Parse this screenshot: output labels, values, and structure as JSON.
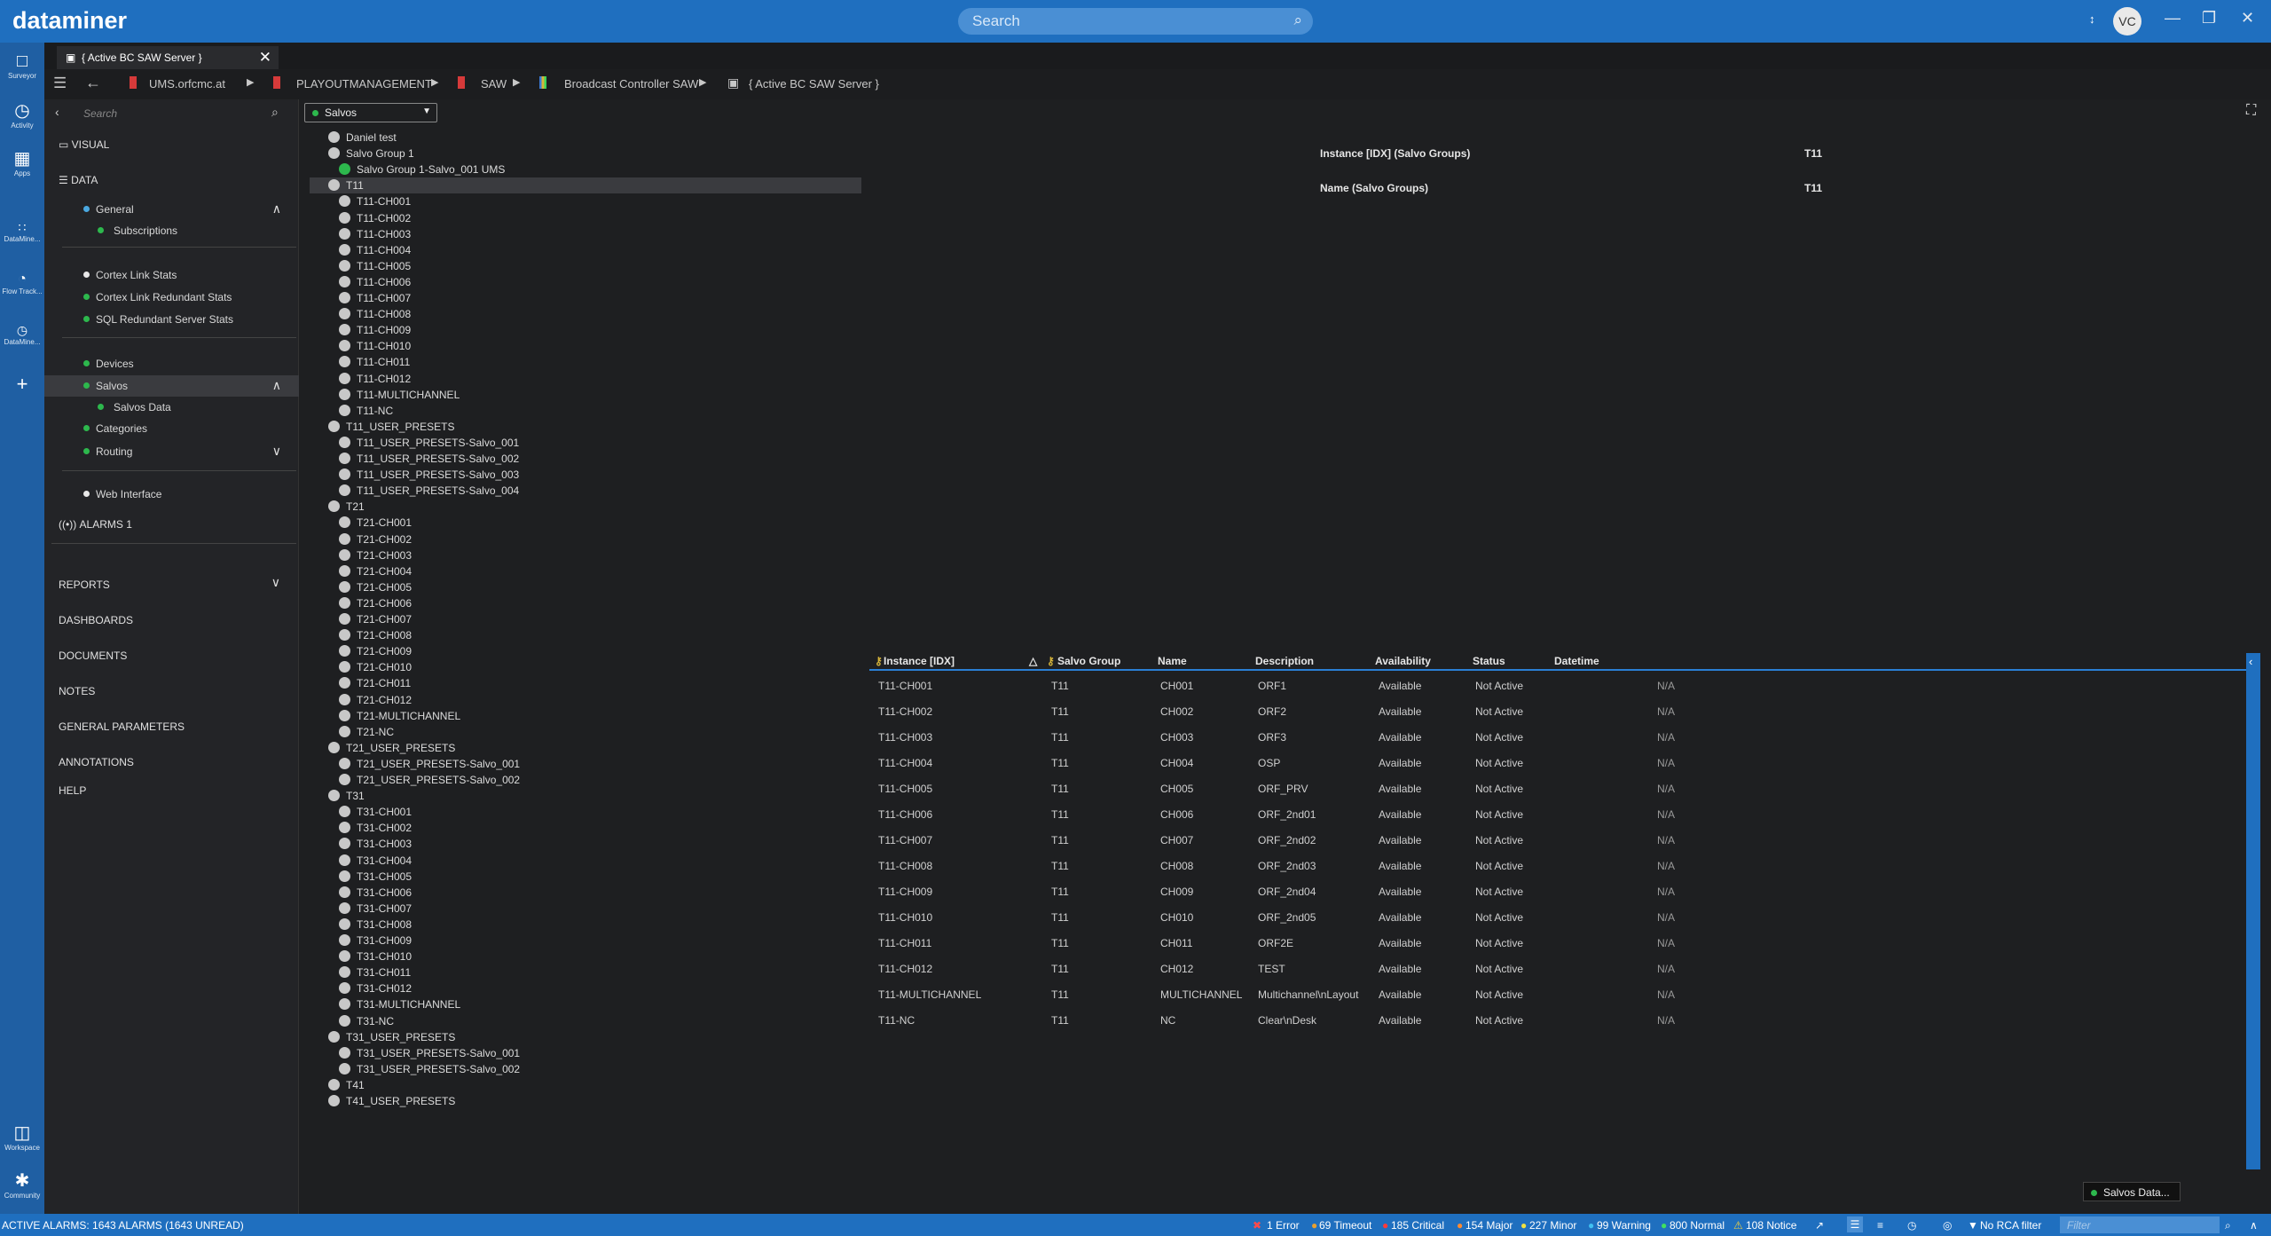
{
  "app": {
    "title": "dataminer",
    "search_placeholder": "Search",
    "user_initials": "VC"
  },
  "leftbar": {
    "items": [
      {
        "label": "Surveyor",
        "icon": "surveyor-icon"
      },
      {
        "label": "Activity",
        "icon": "clock-icon"
      },
      {
        "label": "Apps",
        "icon": "apps-icon"
      },
      {
        "label": "DataMine...",
        "icon": "datamine-icon"
      },
      {
        "label": "Flow Track...",
        "icon": "flow-icon"
      },
      {
        "label": "DataMine...",
        "icon": "datamine2-icon"
      },
      {
        "label": "Workspace",
        "icon": "workspace-icon"
      },
      {
        "label": "Community",
        "icon": "community-icon"
      }
    ]
  },
  "tab": {
    "label": "{ Active BC SAW Server }"
  },
  "breadcrumb": [
    "UMS.orfcmc.at",
    "PLAYOUTMANAGEMENT",
    "SAW",
    "Broadcast Controller SAW",
    "{ Active BC SAW Server }"
  ],
  "nav": {
    "search_placeholder": "Search",
    "visual": "VISUAL",
    "data": "DATA",
    "general": "General",
    "subscriptions": "Subscriptions",
    "cortex_link_stats": "Cortex Link Stats",
    "cortex_link_redundant_stats": "Cortex Link Redundant Stats",
    "sql_redundant_server_stats": "SQL Redundant Server Stats",
    "devices": "Devices",
    "salvos": "Salvos",
    "salvos_data": "Salvos Data",
    "categories": "Categories",
    "routing": "Routing",
    "web_interface": "Web Interface",
    "alarms": "ALARMS 1",
    "reports": "REPORTS",
    "dashboards": "DASHBOARDS",
    "documents": "DOCUMENTS",
    "notes": "NOTES",
    "general_parameters": "GENERAL PARAMETERS",
    "annotations": "ANNOTATIONS",
    "help": "HELP"
  },
  "salvo_dropdown": "Salvos",
  "tree": [
    {
      "label": "Daniel test",
      "level": 0
    },
    {
      "label": "Salvo Group 1",
      "level": 0
    },
    {
      "label": "Salvo Group 1-Salvo_001 UMS",
      "level": 1,
      "green": true
    },
    {
      "label": "T11",
      "level": 0,
      "selected": true
    },
    {
      "label": "T11-CH001",
      "level": 1
    },
    {
      "label": "T11-CH002",
      "level": 1
    },
    {
      "label": "T11-CH003",
      "level": 1
    },
    {
      "label": "T11-CH004",
      "level": 1
    },
    {
      "label": "T11-CH005",
      "level": 1
    },
    {
      "label": "T11-CH006",
      "level": 1
    },
    {
      "label": "T11-CH007",
      "level": 1
    },
    {
      "label": "T11-CH008",
      "level": 1
    },
    {
      "label": "T11-CH009",
      "level": 1
    },
    {
      "label": "T11-CH010",
      "level": 1
    },
    {
      "label": "T11-CH011",
      "level": 1
    },
    {
      "label": "T11-CH012",
      "level": 1
    },
    {
      "label": "T11-MULTICHANNEL",
      "level": 1
    },
    {
      "label": "T11-NC",
      "level": 1
    },
    {
      "label": "T11_USER_PRESETS",
      "level": 0
    },
    {
      "label": "T11_USER_PRESETS-Salvo_001",
      "level": 1
    },
    {
      "label": "T11_USER_PRESETS-Salvo_002",
      "level": 1
    },
    {
      "label": "T11_USER_PRESETS-Salvo_003",
      "level": 1
    },
    {
      "label": "T11_USER_PRESETS-Salvo_004",
      "level": 1
    },
    {
      "label": "T21",
      "level": 0
    },
    {
      "label": "T21-CH001",
      "level": 1
    },
    {
      "label": "T21-CH002",
      "level": 1
    },
    {
      "label": "T21-CH003",
      "level": 1
    },
    {
      "label": "T21-CH004",
      "level": 1
    },
    {
      "label": "T21-CH005",
      "level": 1
    },
    {
      "label": "T21-CH006",
      "level": 1
    },
    {
      "label": "T21-CH007",
      "level": 1
    },
    {
      "label": "T21-CH008",
      "level": 1
    },
    {
      "label": "T21-CH009",
      "level": 1
    },
    {
      "label": "T21-CH010",
      "level": 1
    },
    {
      "label": "T21-CH011",
      "level": 1
    },
    {
      "label": "T21-CH012",
      "level": 1
    },
    {
      "label": "T21-MULTICHANNEL",
      "level": 1
    },
    {
      "label": "T21-NC",
      "level": 1
    },
    {
      "label": "T21_USER_PRESETS",
      "level": 0
    },
    {
      "label": "T21_USER_PRESETS-Salvo_001",
      "level": 1
    },
    {
      "label": "T21_USER_PRESETS-Salvo_002",
      "level": 1
    },
    {
      "label": "T31",
      "level": 0
    },
    {
      "label": "T31-CH001",
      "level": 1
    },
    {
      "label": "T31-CH002",
      "level": 1
    },
    {
      "label": "T31-CH003",
      "level": 1
    },
    {
      "label": "T31-CH004",
      "level": 1
    },
    {
      "label": "T31-CH005",
      "level": 1
    },
    {
      "label": "T31-CH006",
      "level": 1
    },
    {
      "label": "T31-CH007",
      "level": 1
    },
    {
      "label": "T31-CH008",
      "level": 1
    },
    {
      "label": "T31-CH009",
      "level": 1
    },
    {
      "label": "T31-CH010",
      "level": 1
    },
    {
      "label": "T31-CH011",
      "level": 1
    },
    {
      "label": "T31-CH012",
      "level": 1
    },
    {
      "label": "T31-MULTICHANNEL",
      "level": 1
    },
    {
      "label": "T31-NC",
      "level": 1
    },
    {
      "label": "T31_USER_PRESETS",
      "level": 0
    },
    {
      "label": "T31_USER_PRESETS-Salvo_001",
      "level": 1
    },
    {
      "label": "T31_USER_PRESETS-Salvo_002",
      "level": 1
    },
    {
      "label": "T41",
      "level": 0
    },
    {
      "label": "T41_USER_PRESETS",
      "level": 0
    }
  ],
  "detail": {
    "instance_label": "Instance [IDX] (Salvo Groups)",
    "instance_value": "T11",
    "name_label": "Name (Salvo Groups)",
    "name_value": "T11"
  },
  "table": {
    "columns": [
      "Instance [IDX]",
      "Salvo Group",
      "Name",
      "Description",
      "Availability",
      "Status",
      "Datetime"
    ],
    "rows": [
      [
        "T11-CH001",
        "T11",
        "CH001",
        "ORF1",
        "Available",
        "Not Active",
        "N/A"
      ],
      [
        "T11-CH002",
        "T11",
        "CH002",
        "ORF2",
        "Available",
        "Not Active",
        "N/A"
      ],
      [
        "T11-CH003",
        "T11",
        "CH003",
        "ORF3",
        "Available",
        "Not Active",
        "N/A"
      ],
      [
        "T11-CH004",
        "T11",
        "CH004",
        "OSP",
        "Available",
        "Not Active",
        "N/A"
      ],
      [
        "T11-CH005",
        "T11",
        "CH005",
        "ORF_PRV",
        "Available",
        "Not Active",
        "N/A"
      ],
      [
        "T11-CH006",
        "T11",
        "CH006",
        "ORF_2nd01",
        "Available",
        "Not Active",
        "N/A"
      ],
      [
        "T11-CH007",
        "T11",
        "CH007",
        "ORF_2nd02",
        "Available",
        "Not Active",
        "N/A"
      ],
      [
        "T11-CH008",
        "T11",
        "CH008",
        "ORF_2nd03",
        "Available",
        "Not Active",
        "N/A"
      ],
      [
        "T11-CH009",
        "T11",
        "CH009",
        "ORF_2nd04",
        "Available",
        "Not Active",
        "N/A"
      ],
      [
        "T11-CH010",
        "T11",
        "CH010",
        "ORF_2nd05",
        "Available",
        "Not Active",
        "N/A"
      ],
      [
        "T11-CH011",
        "T11",
        "CH011",
        "ORF2E",
        "Available",
        "Not Active",
        "N/A"
      ],
      [
        "T11-CH012",
        "T11",
        "CH012",
        "TEST",
        "Available",
        "Not Active",
        "N/A"
      ],
      [
        "T11-MULTICHANNEL",
        "T11",
        "MULTICHANNEL",
        "Multichannel\\nLayout",
        "Available",
        "Not Active",
        "N/A"
      ],
      [
        "T11-NC",
        "T11",
        "NC",
        "Clear\\nDesk",
        "Available",
        "Not Active",
        "N/A"
      ]
    ]
  },
  "toast": "Salvos Data...",
  "status": {
    "active_alarms": "ACTIVE ALARMS: 1643 ALARMS (1643 UNREAD)",
    "error": "1 Error",
    "timeout": "69 Timeout",
    "critical": "185 Critical",
    "major": "154 Major",
    "minor": "227 Minor",
    "warning": "99 Warning",
    "normal": "800 Normal",
    "notice": "108 Notice",
    "rca": "No RCA filter",
    "filter_placeholder": "Filter"
  },
  "colors": {
    "accent": "#1f6fbf",
    "ok": "#2db84d",
    "background": "#1e1f21"
  }
}
